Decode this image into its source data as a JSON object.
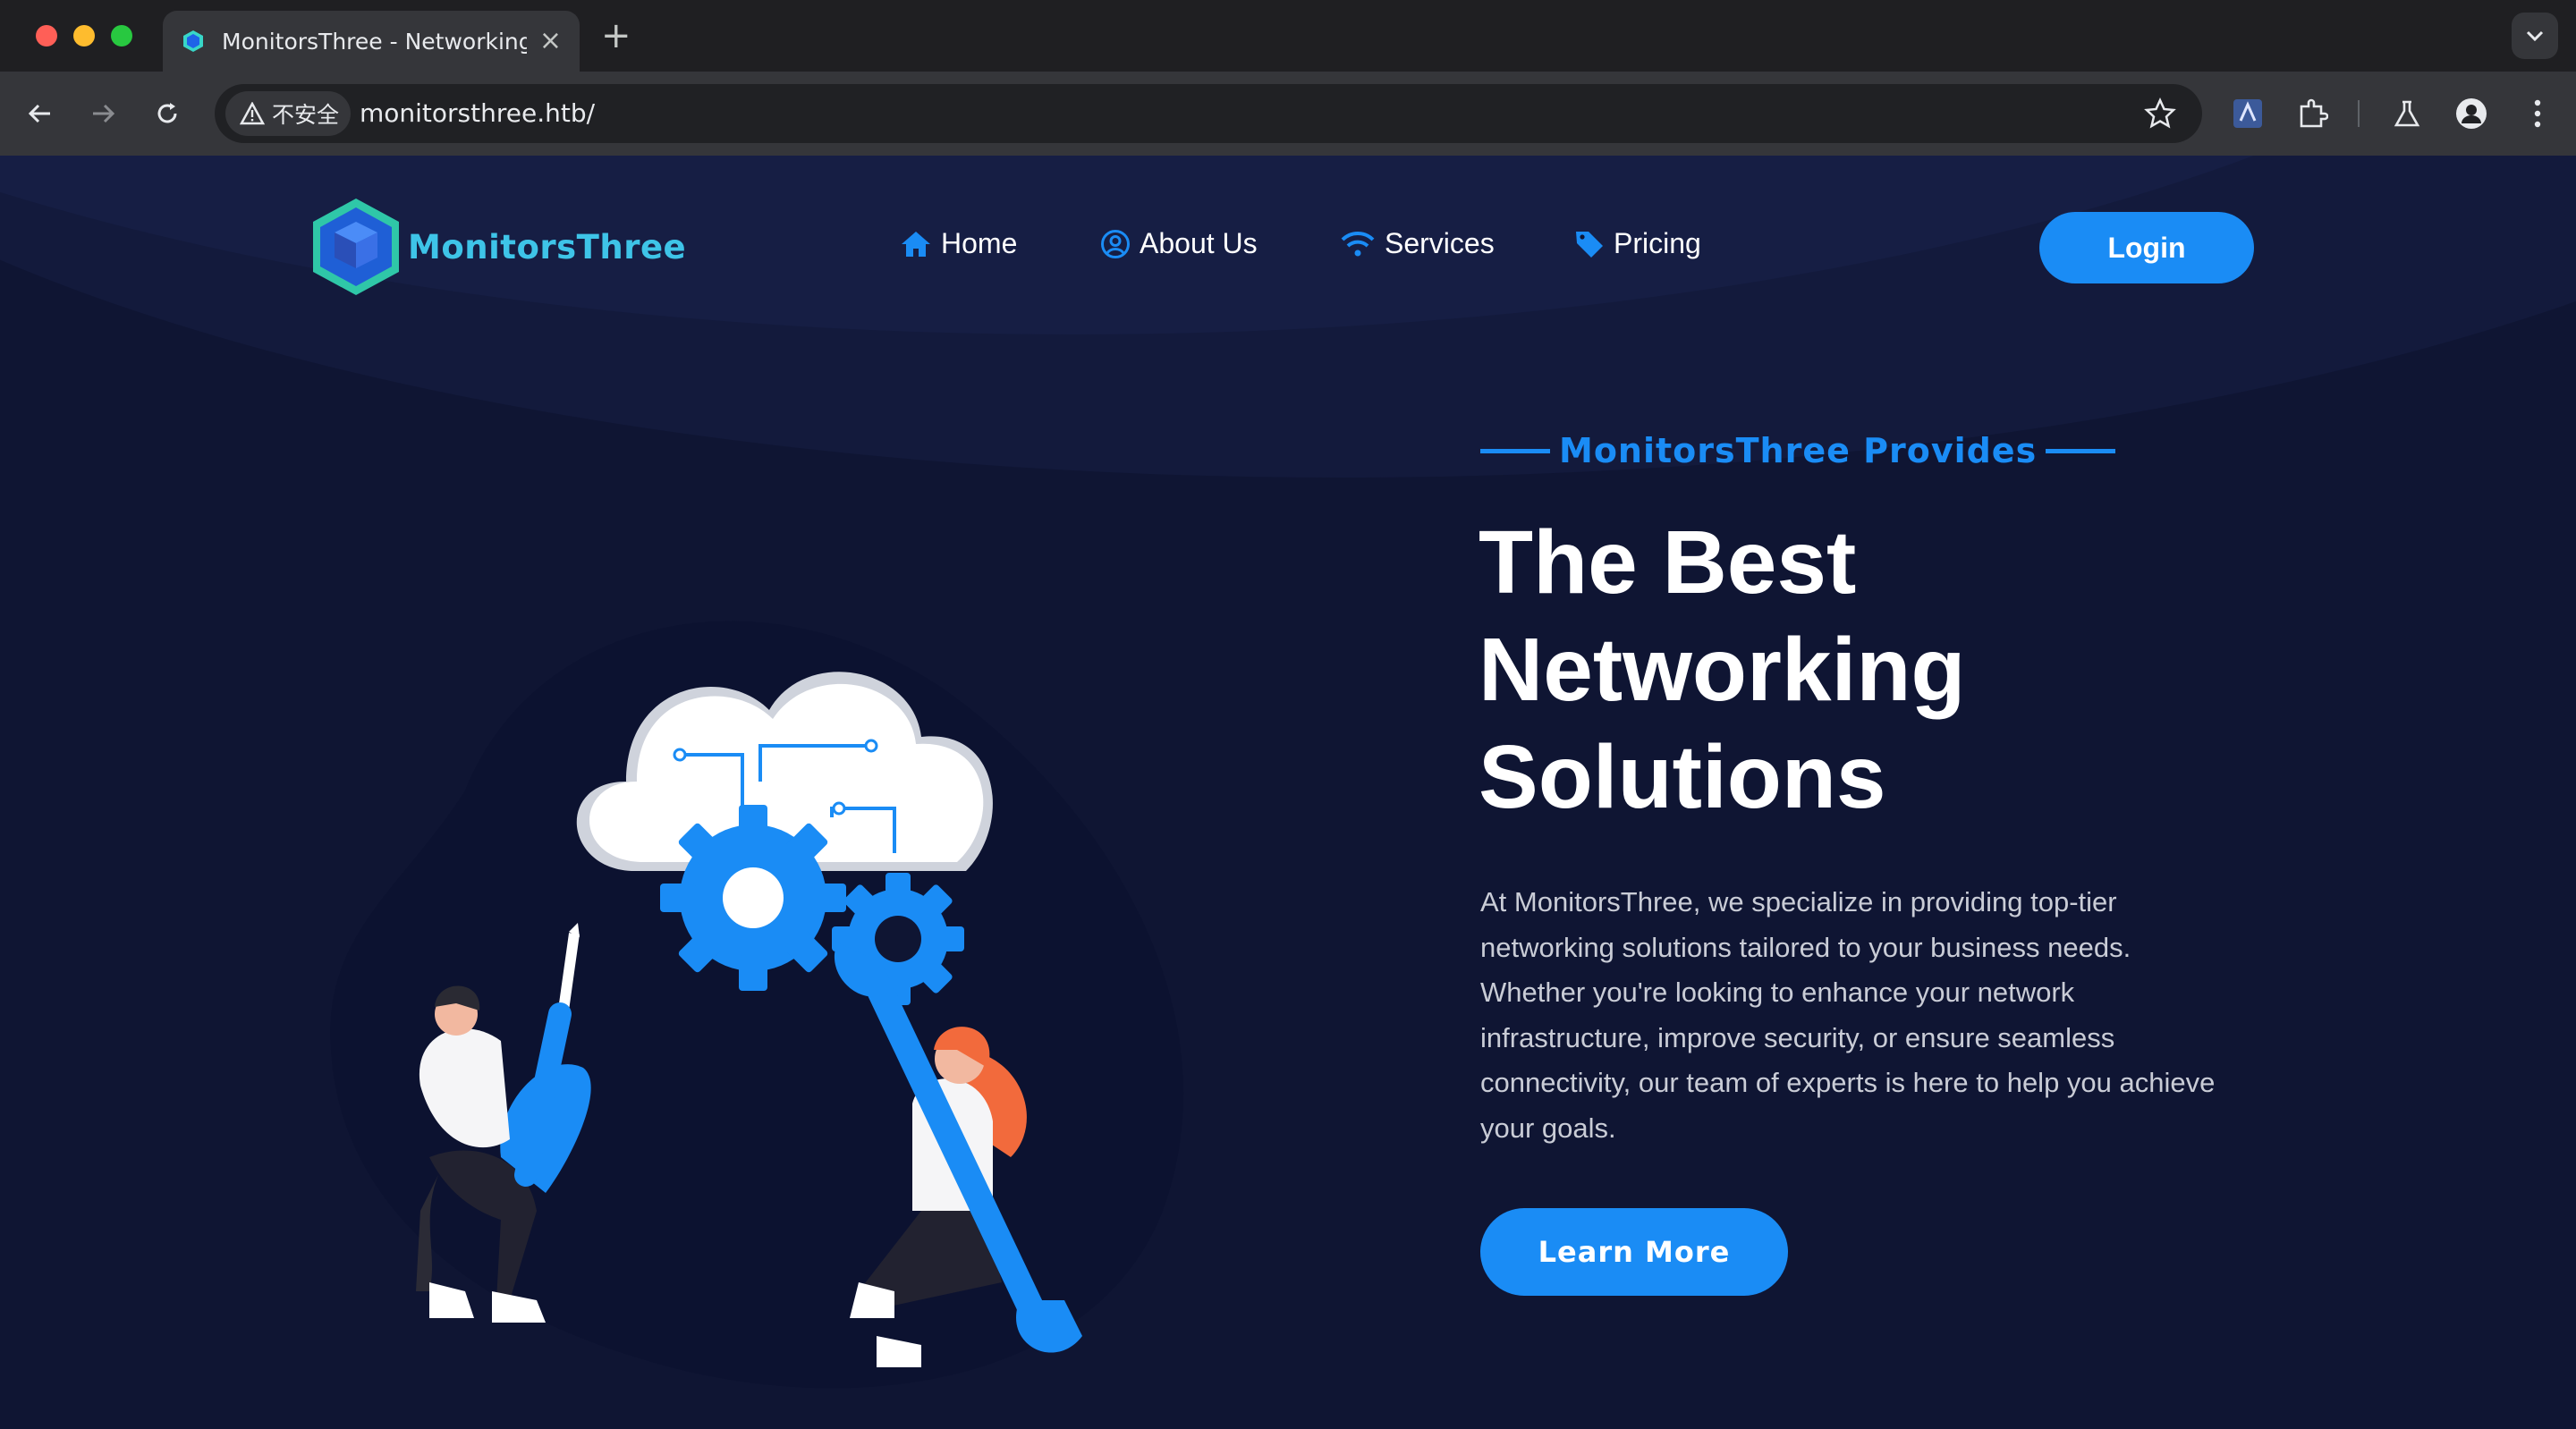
{
  "browser": {
    "tab_title": "MonitorsThree - Networking",
    "security_label": "不安全",
    "url": "monitorsthree.htb/"
  },
  "site": {
    "logo_text": "MonitorsThree",
    "nav": {
      "home": "Home",
      "about": "About Us",
      "services": "Services",
      "pricing": "Pricing"
    },
    "login_label": "Login"
  },
  "hero": {
    "eyebrow": "MonitorsThree Provides",
    "headline_lines": [
      "The Best",
      "Networking",
      "Solutions"
    ],
    "body_lines": [
      "At MonitorsThree, we specialize in providing top-tier",
      "networking solutions tailored to your business needs.",
      "Whether you're looking to enhance your network",
      "infrastructure, improve security, or ensure seamless",
      "connectivity, our team of experts is here to help you achieve",
      "your goals."
    ],
    "cta_label": "Learn More"
  },
  "colors": {
    "page_bg": "#0f1533",
    "accent": "#1a8cf5",
    "logo_text": "#3ec4e8"
  },
  "icons": [
    "home-icon",
    "user-circle-icon",
    "wifi-icon",
    "tag-icon",
    "star-icon",
    "extension-icon",
    "labs-icon",
    "profile-icon",
    "kebab-menu-icon"
  ]
}
